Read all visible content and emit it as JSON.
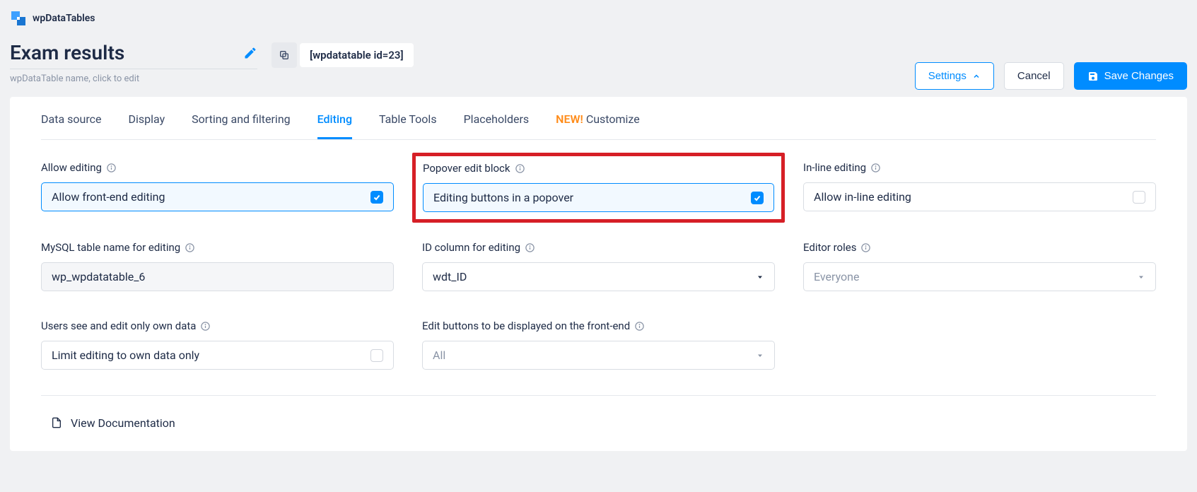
{
  "brand": {
    "name": "wpDataTables"
  },
  "title": {
    "value": "Exam results",
    "hint": "wpDataTable name, click to edit"
  },
  "shortcode": {
    "text": "[wpdatatable id=23]"
  },
  "actions": {
    "settings": "Settings",
    "cancel": "Cancel",
    "save": "Save Changes"
  },
  "tabs": {
    "data_source": "Data source",
    "display": "Display",
    "sorting": "Sorting and filtering",
    "editing": "Editing",
    "tools": "Table Tools",
    "placeholders": "Placeholders",
    "new_prefix": "NEW!",
    "customize": "Customize"
  },
  "fields": {
    "allow_editing": {
      "label": "Allow editing",
      "value": "Allow front-end editing"
    },
    "popover": {
      "label": "Popover edit block",
      "value": "Editing buttons in a popover"
    },
    "inline": {
      "label": "In-line editing",
      "value": "Allow in-line editing"
    },
    "mysql_table": {
      "label": "MySQL table name for editing",
      "value": "wp_wpdatatable_6"
    },
    "id_column": {
      "label": "ID column for editing",
      "value": "wdt_ID"
    },
    "editor_roles": {
      "label": "Editor roles",
      "placeholder": "Everyone"
    },
    "own_data": {
      "label": "Users see and edit only own data",
      "value": "Limit editing to own data only"
    },
    "edit_buttons": {
      "label": "Edit buttons to be displayed on the front-end",
      "placeholder": "All"
    }
  },
  "doc_link": "View Documentation"
}
